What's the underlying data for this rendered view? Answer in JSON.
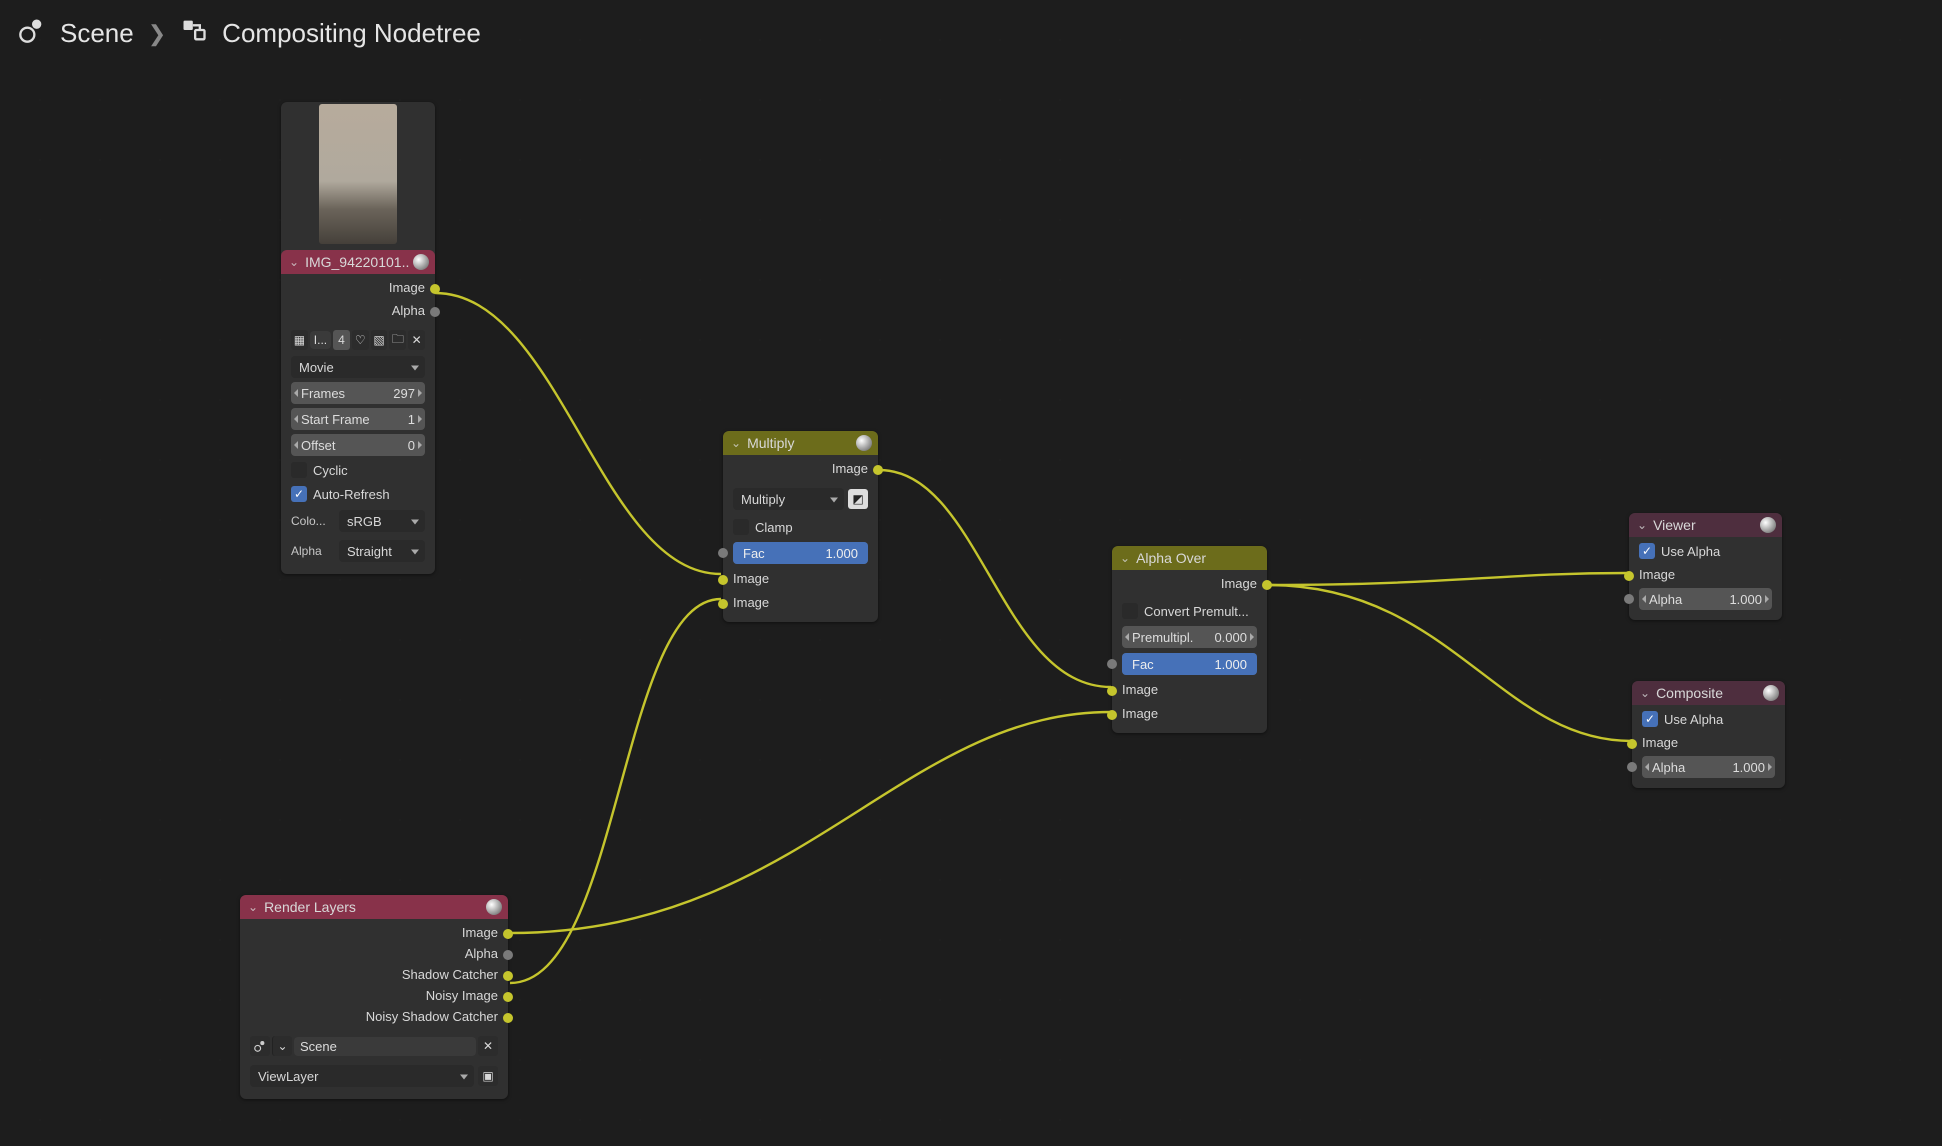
{
  "breadcrumb": {
    "scene": "Scene",
    "nodetree": "Compositing Nodetree"
  },
  "nodes": {
    "image_node": {
      "title": "IMG_942201​01..",
      "out_image": "Image",
      "out_alpha": "Alpha",
      "browser_label": "I...",
      "users": "4",
      "source_dropdown": "Movie",
      "frames_label": "Frames",
      "frames_value": "297",
      "start_label": "Start Frame",
      "start_value": "1",
      "offset_label": "Offset",
      "offset_value": "0",
      "cyclic": "Cyclic",
      "autorefresh": "Auto-Refresh",
      "colorspace_label": "Colo...",
      "colorspace_value": "sRGB",
      "alpha_label": "Alpha",
      "alpha_value": "Straight"
    },
    "multiply_node": {
      "title": "Multiply",
      "out_image": "Image",
      "blend_mode": "Multiply",
      "clamp": "Clamp",
      "fac_label": "Fac",
      "fac_value": "1.000",
      "in_image1": "Image",
      "in_image2": "Image"
    },
    "alphaover_node": {
      "title": "Alpha Over",
      "out_image": "Image",
      "convert": "Convert Premult...",
      "premul_label": "Premultipl.",
      "premul_value": "0.000",
      "fac_label": "Fac",
      "fac_value": "1.000",
      "in_image1": "Image",
      "in_image2": "Image"
    },
    "viewer_node": {
      "title": "Viewer",
      "use_alpha": "Use Alpha",
      "in_image": "Image",
      "alpha_label": "Alpha",
      "alpha_value": "1.000"
    },
    "composite_node": {
      "title": "Composite",
      "use_alpha": "Use Alpha",
      "in_image": "Image",
      "alpha_label": "Alpha",
      "alpha_value": "1.000"
    },
    "renderlayers_node": {
      "title": "Render Layers",
      "out_image": "Image",
      "out_alpha": "Alpha",
      "out_shadowcatcher": "Shadow Catcher",
      "out_noisyimage": "Noisy Image",
      "out_noisyshadow": "Noisy Shadow Catcher",
      "scene": "Scene",
      "viewlayer": "ViewLayer"
    }
  },
  "colors": {
    "hdr_image": "#88324a",
    "hdr_mix": "#6c6c1b",
    "hdr_rl": "#88324a",
    "hdr_viewer": "#4e2e3e",
    "hdr_composite": "#4e2e3e"
  }
}
